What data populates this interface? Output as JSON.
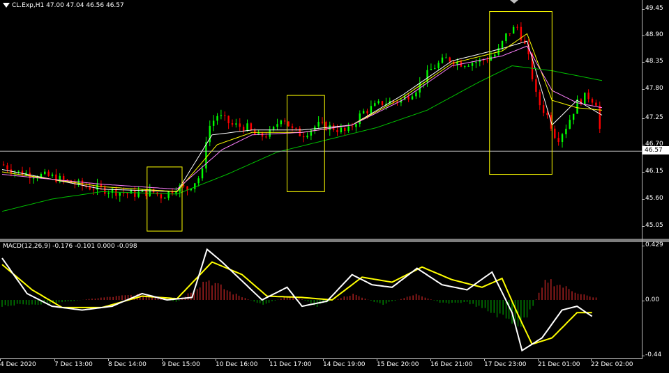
{
  "chart": {
    "title": "CL.Exp,H1  47.00 47.04 46.56 46.57",
    "current_price": "46.57",
    "colors": {
      "background": "#000000",
      "bull_candle": "#00ff00",
      "bear_candle": "#ff0000",
      "ma_fast": "#ffffff",
      "ma_mid": "#ffff00",
      "ma_slow": "#ff80ff",
      "ma_long": "#00c000",
      "highlight_box": "#ffff00",
      "macd_main": "#ffffff",
      "macd_signal": "#ffff00",
      "hist_up": "#ff3030",
      "hist_down": "#00c000"
    }
  },
  "macd": {
    "title": "MACD(12,26,9) -0.176 -0.101 0.000 -0.098"
  },
  "price_axis": {
    "labels": [
      "49.45",
      "48.90",
      "48.35",
      "47.80",
      "47.25",
      "46.70",
      "46.15",
      "45.60",
      "45.05"
    ]
  },
  "macd_axis": {
    "labels": [
      "0.429",
      "0.00",
      "-0.44"
    ]
  },
  "time_axis": {
    "labels": [
      "4 Dec 2020",
      "7 Dec 13:00",
      "8 Dec 14:00",
      "9 Dec 15:00",
      "10 Dec 16:00",
      "11 Dec 17:00",
      "14 Dec 19:00",
      "15 Dec 20:00",
      "16 Dec 21:00",
      "17 Dec 23:00",
      "21 Dec 01:00",
      "22 Dec 02:00"
    ]
  },
  "chart_data": {
    "type": "line",
    "symbol": "CL.Exp",
    "timeframe": "H1",
    "ohlc_last": {
      "open": 47.0,
      "high": 47.04,
      "low": 46.56,
      "close": 46.57
    },
    "y_range": [
      44.85,
      49.65
    ],
    "price_ticks": [
      49.45,
      48.9,
      48.35,
      47.8,
      47.25,
      46.7,
      46.15,
      45.6,
      45.05
    ],
    "x_ticks": [
      "4 Dec 2020",
      "7 Dec 13:00",
      "8 Dec 14:00",
      "9 Dec 15:00",
      "10 Dec 16:00",
      "11 Dec 17:00",
      "14 Dec 19:00",
      "15 Dec 20:00",
      "16 Dec 21:00",
      "17 Dec 23:00",
      "21 Dec 01:00",
      "22 Dec 02:00"
    ],
    "close_path": [
      [
        0,
        46.3
      ],
      [
        0.3,
        46.15
      ],
      [
        0.6,
        46.1
      ],
      [
        1.0,
        46.05
      ],
      [
        1.3,
        45.95
      ],
      [
        1.7,
        45.85
      ],
      [
        2.0,
        45.8
      ],
      [
        2.3,
        45.75
      ],
      [
        2.6,
        45.7
      ],
      [
        3.0,
        45.75
      ],
      [
        3.2,
        45.65
      ],
      [
        3.5,
        45.85
      ],
      [
        3.7,
        45.8
      ],
      [
        4.0,
        46.1
      ],
      [
        4.1,
        47.0
      ],
      [
        4.3,
        47.3
      ],
      [
        4.6,
        47.1
      ],
      [
        4.9,
        47.05
      ],
      [
        5.1,
        46.85
      ],
      [
        5.4,
        46.95
      ],
      [
        5.6,
        47.3
      ],
      [
        5.8,
        47.0
      ],
      [
        6.0,
        46.9
      ],
      [
        6.3,
        47.1
      ],
      [
        6.6,
        47.05
      ],
      [
        6.9,
        46.95
      ],
      [
        7.2,
        47.35
      ],
      [
        7.6,
        47.55
      ],
      [
        8.0,
        47.6
      ],
      [
        8.3,
        47.85
      ],
      [
        8.6,
        48.25
      ],
      [
        8.9,
        48.45
      ],
      [
        9.2,
        48.35
      ],
      [
        9.6,
        48.4
      ],
      [
        9.9,
        48.55
      ],
      [
        10.1,
        48.95
      ],
      [
        10.3,
        49.1
      ],
      [
        10.5,
        48.6
      ],
      [
        10.7,
        47.6
      ],
      [
        10.9,
        47.3
      ],
      [
        11.1,
        46.8
      ],
      [
        11.3,
        47.1
      ],
      [
        11.5,
        47.55
      ],
      [
        11.7,
        47.7
      ],
      [
        11.9,
        47.55
      ],
      [
        12.0,
        46.57
      ]
    ],
    "moving_averages": [
      {
        "values": [
          [
            0,
            46.2
          ],
          [
            2,
            45.8
          ],
          [
            3.5,
            45.75
          ],
          [
            4.2,
            46.9
          ],
          [
            5,
            47.0
          ],
          [
            6,
            47.0
          ],
          [
            7,
            47.1
          ],
          [
            8,
            47.7
          ],
          [
            9,
            48.4
          ],
          [
            10,
            48.65
          ],
          [
            10.5,
            48.8
          ],
          [
            11,
            47.1
          ],
          [
            11.5,
            47.6
          ],
          [
            12,
            47.3
          ]
        ]
      },
      {
        "values": [
          [
            0,
            46.15
          ],
          [
            2,
            45.85
          ],
          [
            3.5,
            45.75
          ],
          [
            4.3,
            46.7
          ],
          [
            5,
            46.95
          ],
          [
            6,
            46.95
          ],
          [
            7,
            47.1
          ],
          [
            8,
            47.65
          ],
          [
            9,
            48.35
          ],
          [
            10,
            48.6
          ],
          [
            10.5,
            48.95
          ],
          [
            11,
            47.6
          ],
          [
            11.5,
            47.45
          ],
          [
            12,
            47.4
          ]
        ]
      },
      {
        "values": [
          [
            0,
            46.1
          ],
          [
            2,
            45.9
          ],
          [
            3.5,
            45.8
          ],
          [
            4.4,
            46.6
          ],
          [
            5,
            46.9
          ],
          [
            6,
            46.95
          ],
          [
            7,
            47.1
          ],
          [
            8,
            47.6
          ],
          [
            9,
            48.3
          ],
          [
            10,
            48.5
          ],
          [
            10.5,
            48.7
          ],
          [
            11,
            47.8
          ],
          [
            11.5,
            47.55
          ],
          [
            12,
            47.45
          ]
        ]
      },
      {
        "values": [
          [
            0,
            45.35
          ],
          [
            1,
            45.6
          ],
          [
            2,
            45.75
          ],
          [
            3.5,
            45.7
          ],
          [
            4.5,
            46.1
          ],
          [
            5.5,
            46.55
          ],
          [
            6.5,
            46.8
          ],
          [
            7.5,
            47.05
          ],
          [
            8.5,
            47.4
          ],
          [
            9.5,
            47.95
          ],
          [
            10.2,
            48.3
          ],
          [
            11,
            48.2
          ],
          [
            12,
            48.0
          ]
        ]
      }
    ],
    "highlight_boxes": [
      {
        "x0": 2.9,
        "x1": 3.6,
        "y_top": 46.25,
        "y_bottom": 44.95
      },
      {
        "x0": 5.7,
        "x1": 6.45,
        "y_top": 47.7,
        "y_bottom": 45.75
      },
      {
        "x0": 9.75,
        "x1": 11.0,
        "y_top": 49.4,
        "y_bottom": 46.1
      }
    ],
    "macd": {
      "params": [
        12,
        26,
        9
      ],
      "values": {
        "main": -0.176,
        "signal": -0.101,
        "histogram_level": 0.0,
        "last": -0.098
      },
      "y_range": [
        -0.44,
        0.429
      ],
      "main_path": [
        [
          0,
          0.33
        ],
        [
          0.5,
          0.05
        ],
        [
          1.0,
          -0.05
        ],
        [
          1.6,
          -0.08
        ],
        [
          2.2,
          -0.05
        ],
        [
          2.8,
          0.05
        ],
        [
          3.3,
          0.0
        ],
        [
          3.8,
          0.02
        ],
        [
          4.1,
          0.4
        ],
        [
          4.4,
          0.3
        ],
        [
          4.8,
          0.15
        ],
        [
          5.2,
          0.0
        ],
        [
          5.7,
          0.1
        ],
        [
          6.0,
          -0.05
        ],
        [
          6.5,
          -0.01
        ],
        [
          7.0,
          0.2
        ],
        [
          7.4,
          0.12
        ],
        [
          7.8,
          0.1
        ],
        [
          8.3,
          0.25
        ],
        [
          8.8,
          0.12
        ],
        [
          9.3,
          0.08
        ],
        [
          9.8,
          0.22
        ],
        [
          10.2,
          -0.1
        ],
        [
          10.4,
          -0.4
        ],
        [
          10.8,
          -0.3
        ],
        [
          11.2,
          -0.08
        ],
        [
          11.5,
          -0.05
        ],
        [
          11.8,
          -0.13
        ]
      ],
      "signal_path": [
        [
          0,
          0.28
        ],
        [
          0.6,
          0.08
        ],
        [
          1.2,
          -0.06
        ],
        [
          2.0,
          -0.06
        ],
        [
          2.8,
          0.03
        ],
        [
          3.5,
          0.01
        ],
        [
          4.2,
          0.3
        ],
        [
          4.8,
          0.2
        ],
        [
          5.3,
          0.03
        ],
        [
          6.0,
          0.02
        ],
        [
          6.6,
          0.0
        ],
        [
          7.2,
          0.18
        ],
        [
          7.8,
          0.14
        ],
        [
          8.4,
          0.26
        ],
        [
          9.0,
          0.16
        ],
        [
          9.6,
          0.1
        ],
        [
          10.0,
          0.17
        ],
        [
          10.3,
          -0.1
        ],
        [
          10.6,
          -0.35
        ],
        [
          11.0,
          -0.3
        ],
        [
          11.5,
          -0.1
        ],
        [
          11.8,
          -0.1
        ]
      ],
      "histogram": [
        [
          0,
          -0.05
        ],
        [
          1,
          -0.03
        ],
        [
          2,
          0.02
        ],
        [
          2.8,
          0.05
        ],
        [
          3.5,
          -0.02
        ],
        [
          4.1,
          0.18
        ],
        [
          4.6,
          0.06
        ],
        [
          5.2,
          -0.04
        ],
        [
          5.8,
          0.04
        ],
        [
          6.3,
          -0.05
        ],
        [
          7.0,
          0.05
        ],
        [
          7.6,
          -0.04
        ],
        [
          8.3,
          0.05
        ],
        [
          8.8,
          -0.03
        ],
        [
          9.3,
          -0.02
        ],
        [
          10.4,
          -0.22
        ],
        [
          10.9,
          0.18
        ],
        [
          11.3,
          0.1
        ],
        [
          11.8,
          0.02
        ]
      ]
    }
  }
}
